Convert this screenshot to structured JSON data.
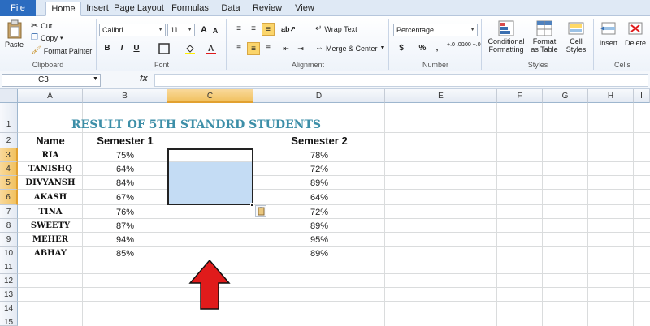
{
  "ribbon": {
    "tabs": [
      "File",
      "Home",
      "Insert",
      "Page Layout",
      "Formulas",
      "Data",
      "Review",
      "View"
    ],
    "clipboard": {
      "paste": "Paste",
      "cut": "Cut",
      "copy": "Copy",
      "copy_arrow": "▾",
      "format_painter": "Format Painter",
      "label": "Clipboard"
    },
    "font": {
      "name": "Calibri",
      "size": "11",
      "bold": "B",
      "italic": "I",
      "underline": "U",
      "label": "Font"
    },
    "alignment": {
      "wrap_text": "Wrap Text",
      "merge_center": "Merge & Center",
      "label": "Alignment"
    },
    "number": {
      "format": "Percentage",
      "currency": "$",
      "percent": "%",
      "comma": ",",
      "inc_decimal": "+.0 .00",
      "dec_decimal": ".00 +.0",
      "label": "Number"
    },
    "styles": {
      "conditional_1": "Conditional",
      "conditional_2": "Formatting",
      "format_table_1": "Format",
      "format_table_2": "as Table",
      "cell_styles_1": "Cell",
      "cell_styles_2": "Styles",
      "label": "Styles"
    },
    "cells": {
      "insert": "Insert",
      "delete": "Delete",
      "label": "Cells"
    }
  },
  "formula_bar": {
    "name_box": "C3",
    "fx": "fx",
    "value": ""
  },
  "sheet": {
    "columns": [
      "A",
      "B",
      "C",
      "D",
      "E",
      "F",
      "G",
      "H",
      "I"
    ],
    "rows": [
      "1",
      "2",
      "3",
      "4",
      "5",
      "6",
      "7",
      "8",
      "9",
      "10",
      "11",
      "12",
      "13",
      "14",
      "15"
    ],
    "title": "RESULT OF 5TH STANDRD STUDENTS",
    "header_name": "Name",
    "header_sem1": "Semester 1",
    "header_sem2": "Semester 2",
    "students": [
      {
        "name": "RIA",
        "sem1": "75%",
        "sem2": "78%"
      },
      {
        "name": "TANISHQ",
        "sem1": "64%",
        "sem2": "72%"
      },
      {
        "name": "DIVYANSH",
        "sem1": "84%",
        "sem2": "89%"
      },
      {
        "name": "AKASH",
        "sem1": "67%",
        "sem2": "64%"
      },
      {
        "name": "TINA",
        "sem1": "76%",
        "sem2": "72%"
      },
      {
        "name": "SWEETY",
        "sem1": "87%",
        "sem2": "89%"
      },
      {
        "name": "MEHER",
        "sem1": "94%",
        "sem2": "95%"
      },
      {
        "name": "ABHAY",
        "sem1": "85%",
        "sem2": "89%"
      }
    ],
    "selected_range": "C3:C6",
    "accent_color": "#3d8fa8",
    "arrow_color": "#e01b1b"
  }
}
